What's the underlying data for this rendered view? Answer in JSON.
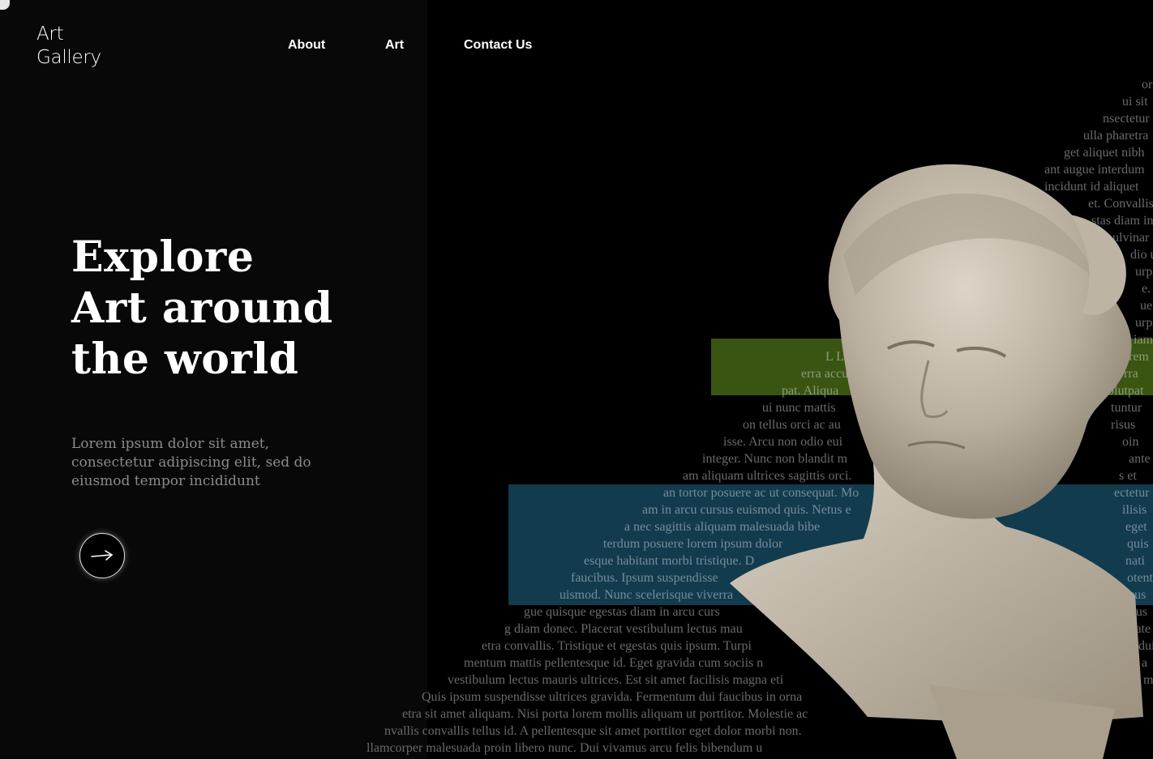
{
  "brand": {
    "line1": "Art",
    "line2": "Gallery"
  },
  "nav": {
    "about": "About",
    "art": "Art",
    "contact": "Contact Us"
  },
  "hero": {
    "title_lines": [
      "Explore",
      "Art around",
      "the world"
    ],
    "text_lines": [
      "Lorem ipsum dolor sit amet,",
      "consectetur adipiscing elit, sed do",
      "eiusmod tempor incididunt"
    ]
  },
  "cta": {
    "icon": "arrow-right-icon"
  },
  "background_text_lines": [
    "or",
    "ui sit",
    "nsectetur",
    "ulla pharetra",
    "get aliquet nibh",
    "ant augue interdum",
    "incidunt id aliquet",
    "et. Convallis",
    "stas diam in",
    "ulvinar",
    "dio ut",
    "urpis",
    "e. In",
    "ue",
    "urpis",
    "iam",
    "L Lorem",
    "erra accu",
    "pat. Aliqua",
    "ui nunc mattis",
    "on tellus orci ac au",
    "isse. Arcu non odio eui",
    "integer. Nunc non blandit m",
    "am aliquam ultrices sagittis orci.",
    "an tortor posuere ac ut consequat. Mo",
    "am in arcu cursus euismod quis. Netus e",
    "a nec sagittis aliquam malesuada bibe",
    "terdum posuere lorem ipsum dolor",
    "esque habitant morbi tristique. D",
    "faucibus. Ipsum suspendisse",
    "uismod. Nunc scelerisque viverra",
    "gue quisque egestas diam in arcu curs",
    "g diam donec. Placerat vestibulum lectus mau",
    "etra convallis. Tristique et egestas quis ipsum. Turpi",
    "mentum mattis pellentesque id. Eget gravida cum sociis n",
    "vestibulum lectus mauris ultrices. Est sit amet facilisis magna eti",
    "Quis ipsum suspendisse ultrices gravida. Fermentum dui faucibus in orna",
    "etra sit amet aliquam. Nisi porta lorem mollis aliquam ut porttitor. Molestie ac",
    "nvallis convallis tellus id. A pellentesque sit amet porttitor eget dolor morbi non.",
    "llamcorper malesuada proin libero nunc. Dui vivamus arcu felis bibendum u",
    "orem",
    "rra",
    "olutpat",
    "tuntur",
    "risus",
    "oin",
    "ante",
    "s et",
    "ectetur",
    "ilisis",
    "eget",
    "quis",
    "nati",
    "otent",
    "cus",
    "llus",
    "tate",
    "dui",
    "a",
    "mass"
  ],
  "colors": {
    "green_overlay": "#4a6b16",
    "blue_overlay": "#15485f",
    "panel": "#080808"
  }
}
